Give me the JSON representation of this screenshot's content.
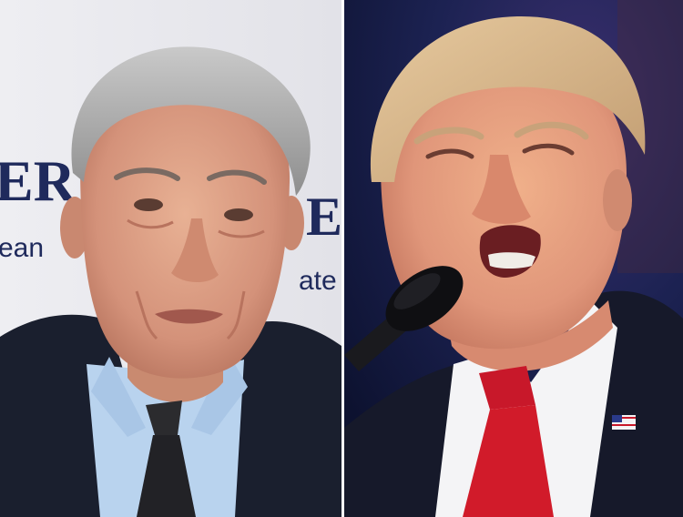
{
  "photo_left": {
    "backdrop_text_top": "ER",
    "backdrop_text_top_right": "E",
    "backdrop_text_sub": "ean",
    "backdrop_text_sub_right": "ate"
  },
  "photo_right": {},
  "colors": {
    "left_backdrop": "#e9e9ee",
    "backdrop_lettering": "#1f2a5c",
    "right_background": "#141a3a",
    "suit_dark": "#1a1f2e",
    "shirt_light_blue": "#b9d3ee",
    "tie_red": "#d11b2a",
    "skin": "#e0a07e"
  }
}
